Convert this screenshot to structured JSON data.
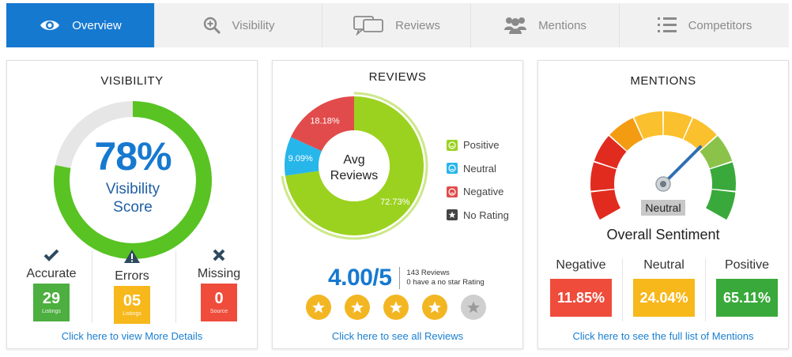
{
  "tabs": [
    {
      "label": "Overview",
      "icon": "eye-icon",
      "active": true
    },
    {
      "label": "Visibility",
      "icon": "magnifier-plus-icon",
      "active": false
    },
    {
      "label": "Reviews",
      "icon": "chat-bubbles-icon",
      "active": false
    },
    {
      "label": "Mentions",
      "icon": "people-icon",
      "active": false
    },
    {
      "label": "Competitors",
      "icon": "ranked-list-icon",
      "active": false
    }
  ],
  "visibility": {
    "title": "VISIBILITY",
    "score": "78%",
    "score_value": 78,
    "score_label_1": "Visibility",
    "score_label_2": "Score",
    "stats": [
      {
        "label": "Accurate",
        "value": "29",
        "sub": "Listings",
        "icon": "checkmark-icon",
        "color": "#4caf3f"
      },
      {
        "label": "Errors",
        "value": "05",
        "sub": "Listings",
        "icon": "warning-icon",
        "color": "#f7b81c"
      },
      {
        "label": "Missing",
        "value": "0",
        "sub": "Source",
        "icon": "cross-icon",
        "color": "#ef4c3b"
      }
    ],
    "link": "Click here to view More Details"
  },
  "reviews": {
    "title": "REVIEWS",
    "center_1": "Avg",
    "center_2": "Reviews",
    "legend": [
      {
        "label": "Positive",
        "color": "#9bd21f",
        "icon": "smile-icon"
      },
      {
        "label": "Neutral",
        "color": "#27b6ea",
        "icon": "neutral-face-icon"
      },
      {
        "label": "Negative",
        "color": "#e14b4b",
        "icon": "sad-face-icon"
      },
      {
        "label": "No Rating",
        "color": "#444444",
        "icon": "star-icon"
      }
    ],
    "rating": "4.00/5",
    "reviews_count_text": "143 Reviews",
    "no_star_text": "0 have a no star Rating",
    "stars_filled": 4,
    "stars_total": 5,
    "link": "Click here to see all Reviews"
  },
  "chart_data": {
    "type": "pie",
    "categories": [
      "Positive",
      "Neutral",
      "Negative"
    ],
    "values": [
      72.73,
      9.09,
      18.18
    ],
    "labels": [
      "72.73%",
      "9.09%",
      "18.18%"
    ],
    "colors": [
      "#9bd21f",
      "#27b6ea",
      "#e14b4b"
    ]
  },
  "mentions": {
    "title": "MENTIONS",
    "needle_label": "Neutral",
    "overall": "Overall Sentiment",
    "stats": [
      {
        "label": "Negative",
        "value": "11.85%",
        "color": "#ef4c3b"
      },
      {
        "label": "Neutral",
        "value": "24.04%",
        "color": "#f7b81c"
      },
      {
        "label": "Positive",
        "value": "65.11%",
        "color": "#3aa93b"
      }
    ],
    "link": "Click here to see the full list of Mentions"
  }
}
